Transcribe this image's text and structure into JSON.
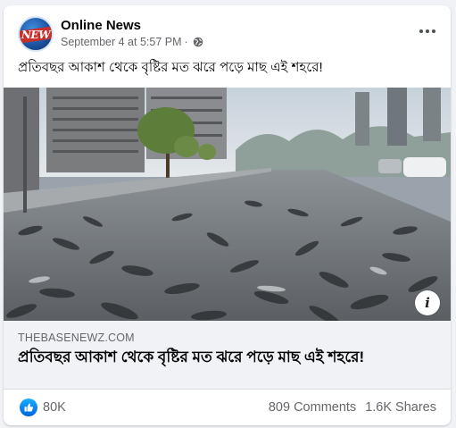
{
  "post": {
    "page_name": "Online News",
    "avatar_text": "NEW",
    "timestamp": "September 4 at 5:57 PM",
    "separator": "·",
    "privacy_icon": "globe-icon",
    "more_icon": "more-horizontal-icon",
    "text": "প্রতিবছর আকাশ থেকে বৃষ্টির মত ঝরে পড়ে মাছ এই শহরে!"
  },
  "link_preview": {
    "domain": "THEBASENEWZ.COM",
    "title": "প্রতিবছর আকাশ থেকে বৃষ্টির মত ঝরে পড়ে মাছ এই শহরে!",
    "info_icon_label": "i"
  },
  "engagement": {
    "like_icon": "like-thumb-icon",
    "like_count": "80K",
    "comments": "809 Comments",
    "shares": "1.6K Shares"
  },
  "colors": {
    "brand_blue": "#1877f2",
    "secondary_text": "#65676b",
    "link_box_bg": "#f0f2f5"
  }
}
